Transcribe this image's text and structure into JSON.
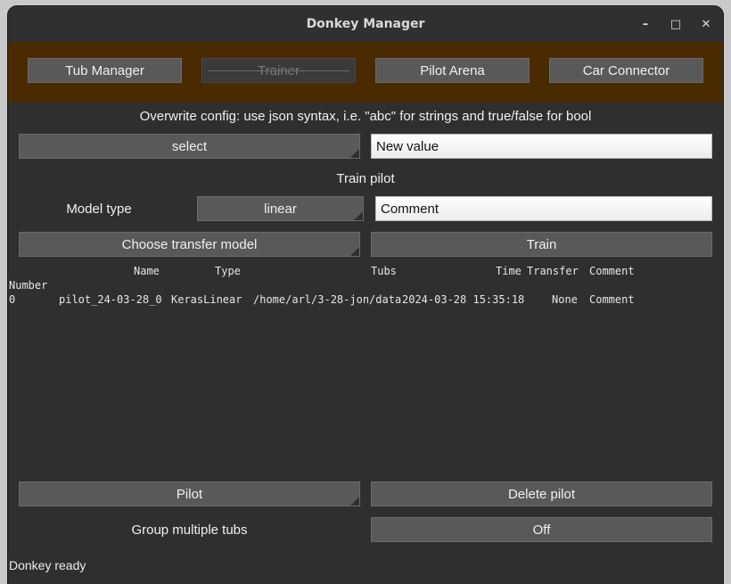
{
  "window": {
    "title": "Donkey Manager"
  },
  "tabs": [
    {
      "label": "Tub Manager"
    },
    {
      "label": "Trainer"
    },
    {
      "label": "Pilot Arena"
    },
    {
      "label": "Car Connector"
    }
  ],
  "config": {
    "hint": "Overwrite config: use json syntax, i.e. \"abc\" for strings and true/false for bool",
    "select_label": "select",
    "value": "New value"
  },
  "train": {
    "heading": "Train pilot",
    "model_type_label": "Model type",
    "model_type_value": "linear",
    "comment_value": "Comment",
    "transfer_button": "Choose transfer model",
    "train_button": "Train"
  },
  "table": {
    "columns": [
      "Name",
      "Type",
      "Tubs",
      "Time",
      "Transfer",
      "Comment"
    ],
    "index_header": "Number",
    "rows": [
      {
        "number": "0",
        "name": "pilot_24-03-28_0",
        "type": "KerasLinear",
        "tubs": "/home/arl/3-28-jon/data",
        "time": "2024-03-28 15:35:18",
        "transfer": "None",
        "comment": "Comment"
      }
    ]
  },
  "bottom": {
    "pilot_button": "Pilot",
    "delete_button": "Delete pilot",
    "group_label": "Group multiple tubs",
    "group_toggle": "Off"
  },
  "status": "Donkey ready"
}
